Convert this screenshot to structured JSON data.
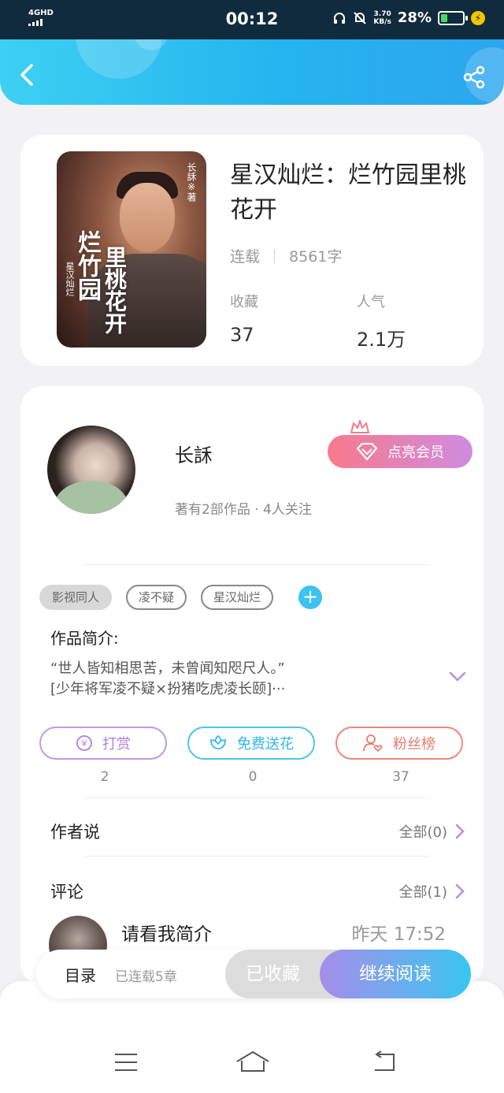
{
  "status_bar": {
    "network": "4GHD",
    "time": "00:12",
    "speed_value": "3.70",
    "speed_unit": "KB/s",
    "battery": "28%"
  },
  "header": {
    "back_icon": "back-arrow-icon",
    "share_icon": "share-icon"
  },
  "book": {
    "title": "星汉灿烂：烂竹园里桃花开",
    "status": "连载",
    "word_count": "8561字",
    "stats": [
      {
        "label": "收藏",
        "value": "37"
      },
      {
        "label": "人气",
        "value": "2.1万"
      }
    ],
    "cover_text": {
      "title_col1": "烂竹园",
      "title_col2": "里桃花开",
      "series": "星汉灿烂",
      "author_mark": "长訸※著"
    }
  },
  "author": {
    "name": "长訸",
    "info": "著有2部作品 · 4人关注",
    "vip_button": "点亮会员"
  },
  "tags": [
    "影视同人",
    "凌不疑",
    "星汉灿烂"
  ],
  "intro": {
    "title": "作品简介:",
    "line1": "“世人皆知相思苦，未曾闻知咫尺人。”",
    "line2": "[少年将军凌不疑×扮猪吃虎凌长颐]···"
  },
  "actions": [
    {
      "label": "打赏",
      "count": "2",
      "icon": "yen-coin-icon"
    },
    {
      "label": "免费送花",
      "count": "0",
      "icon": "flower-icon"
    },
    {
      "label": "粉丝榜",
      "count": "37",
      "icon": "fans-user-heart-icon"
    }
  ],
  "author_says": {
    "label": "作者说",
    "more": "全部(0)"
  },
  "comments": {
    "label": "评论",
    "more": "全部(1)",
    "first": {
      "text": "请看我简介",
      "time": "昨天 17:52"
    }
  },
  "bottom_bar": {
    "toc_label": "目录",
    "toc_sub": "已连载5章",
    "collected_label": "已收藏",
    "read_label": "继续阅读"
  },
  "colors": {
    "header_start": "#3ed0f3",
    "header_end": "#2da6f0",
    "vip_start": "#f77a8b",
    "vip_end": "#cf8be0",
    "read_start": "#a58ee9",
    "read_end": "#38c6f1"
  }
}
